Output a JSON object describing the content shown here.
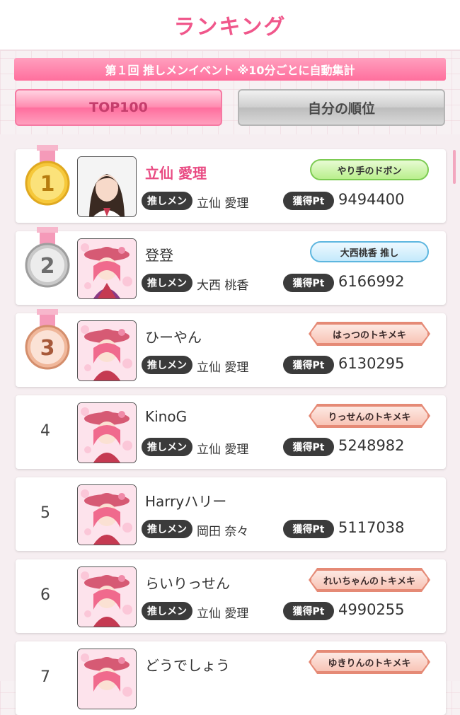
{
  "header": {
    "title": "ランキング"
  },
  "event": {
    "title": "第１回 推しメンイベント ※10分ごとに自動集計"
  },
  "tabs": [
    {
      "label": "TOP100",
      "active": true
    },
    {
      "label": "自分の順位",
      "active": false
    }
  ],
  "labels": {
    "oshimen": "推しメン",
    "points": "獲得Pt"
  },
  "medal_colors": {
    "gold": "#f6c83a",
    "silver": "#c9c9c9",
    "bronze": "#f0b79a",
    "ribbon": "#f59ab9"
  },
  "ranking": [
    {
      "rank": "1",
      "name": "立仙 愛理",
      "oshimen": "立仙 愛理",
      "points": "9494400",
      "badge": "やり手のドボン",
      "badge_style": "green",
      "avatar": "photo"
    },
    {
      "rank": "2",
      "name": "登登",
      "oshimen": "大西 桃香",
      "points": "6166992",
      "badge": "大西桃香 推し",
      "badge_style": "blue",
      "avatar": "character"
    },
    {
      "rank": "3",
      "name": "ひーやん",
      "oshimen": "立仙 愛理",
      "points": "6130295",
      "badge": "はっつのトキメキ",
      "badge_style": "red",
      "avatar": "character"
    },
    {
      "rank": "4",
      "name": "KinoG",
      "oshimen": "立仙 愛理",
      "points": "5248982",
      "badge": "りっせんのトキメキ",
      "badge_style": "red",
      "avatar": "character"
    },
    {
      "rank": "5",
      "name": "Harryハリー",
      "oshimen": "岡田 奈々",
      "points": "5117038",
      "badge": "",
      "badge_style": "none",
      "avatar": "character"
    },
    {
      "rank": "6",
      "name": "らいりっせん",
      "oshimen": "立仙 愛理",
      "points": "4990255",
      "badge": "れいちゃんのトキメキ",
      "badge_style": "red",
      "avatar": "character"
    },
    {
      "rank": "7",
      "name": "どうでしょう",
      "oshimen": "",
      "points": "",
      "badge": "ゆきりんのトキメキ",
      "badge_style": "red",
      "avatar": "character"
    }
  ]
}
